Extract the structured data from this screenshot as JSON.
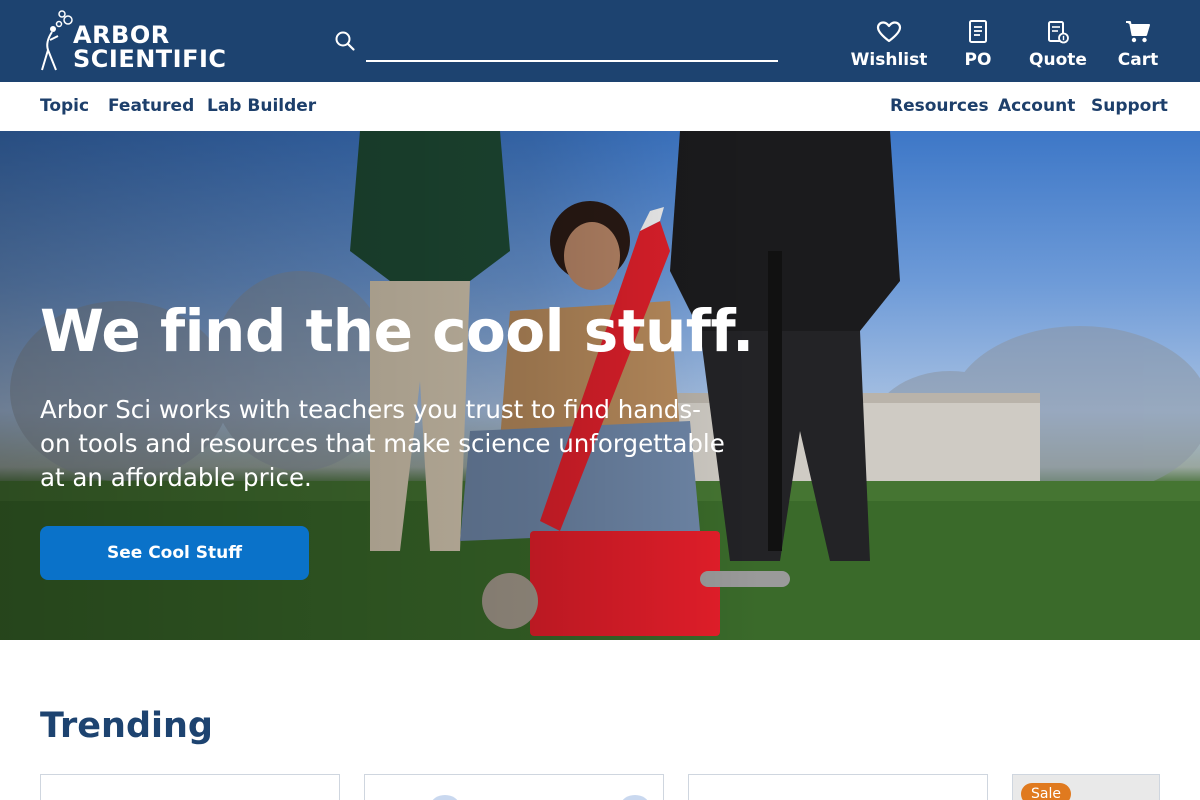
{
  "brand": {
    "line1": "ARBOR",
    "line2": "SCIENTIFIC"
  },
  "search": {
    "placeholder": "",
    "value": ""
  },
  "header_actions": [
    {
      "label": "Wishlist",
      "icon": "heart-icon"
    },
    {
      "label": "PO",
      "icon": "document-icon"
    },
    {
      "label": "Quote",
      "icon": "quote-icon"
    },
    {
      "label": "Cart",
      "icon": "cart-icon"
    }
  ],
  "subnav": {
    "left": [
      "Topic",
      "Featured",
      "Lab Builder"
    ],
    "right": [
      "Resources",
      "Account",
      "Support"
    ]
  },
  "hero": {
    "title": "We find the cool stuff.",
    "subtitle": "Arbor Sci works with teachers you trust to find hands-on tools and resources that make science unforgettable at an affordable price.",
    "button_label": "See Cool Stuff"
  },
  "trending": {
    "title": "Trending",
    "cards": [
      {
        "badge": ""
      },
      {
        "badge": ""
      },
      {
        "badge": ""
      },
      {
        "badge": "Sale"
      }
    ]
  },
  "colors": {
    "header_bg": "#1d4370",
    "nav_text": "#1d3f6b",
    "button_bg": "#0a72c9",
    "sale_badge": "#e07a1f"
  }
}
